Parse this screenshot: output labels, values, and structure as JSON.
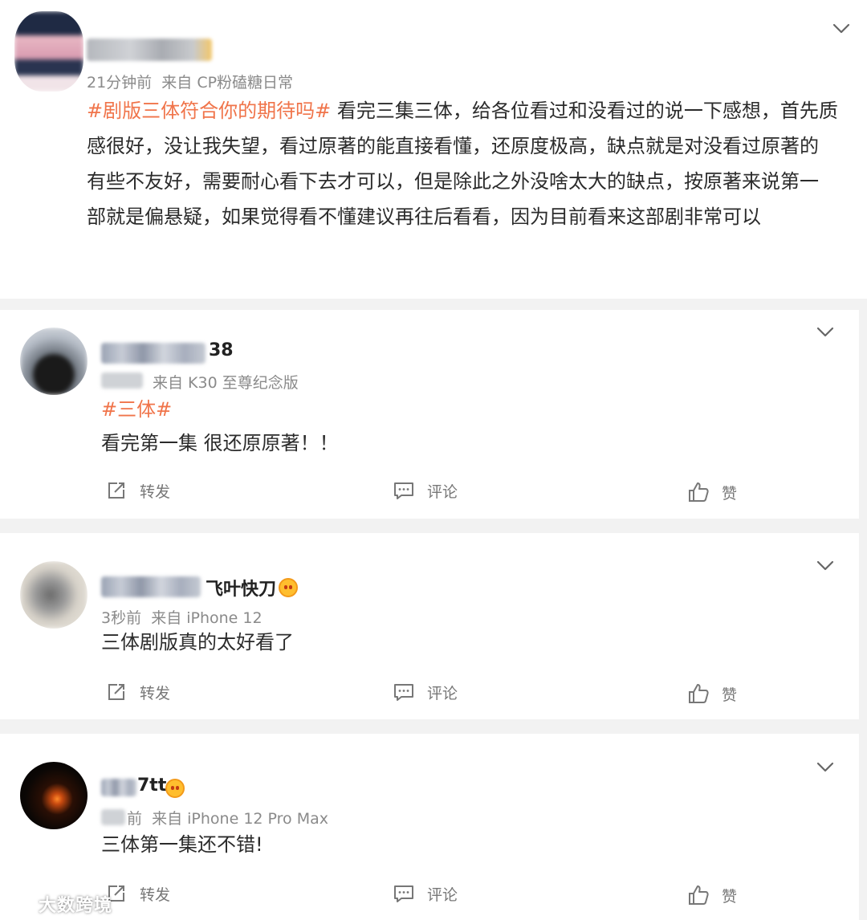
{
  "post": {
    "time": "21分钟前",
    "source": "来自 CP粉磕糖日常",
    "topic": "#剧版三体符合你的期待吗#",
    "lines": [
      "看完三集三体，给各位看过和没看过的说一下感想，首先质",
      "感很好，没让我失望，看过原著的能直接看懂，还原度极高，缺点就是对没看过原著的",
      "有些不友好，需要耐心看下去才可以，但是除此之外没啥太大的缺点，按原著来说第一",
      "部就是偏悬疑，如果觉得看不懂建议再往后看看，因为目前看来这部剧非常可以"
    ]
  },
  "comments": [
    {
      "name_visible": "38",
      "source": "来自 K30 至尊纪念版",
      "topic": "#三体#",
      "text": "看完第一集 很还原原著！！",
      "actions": {
        "repost": "转发",
        "comment": "评论",
        "like": "赞"
      }
    },
    {
      "name_visible": "飞叶快刀",
      "time": "3秒前",
      "source": "来自 iPhone 12",
      "text": "三体剧版真的太好看了",
      "actions": {
        "repost": "转发",
        "comment": "评论",
        "like": "赞"
      }
    },
    {
      "name_visible": "7tt",
      "time_suffix": "前",
      "source": "来自 iPhone 12 Pro Max",
      "text": "三体第一集还不错!",
      "actions": {
        "repost": "转发",
        "comment": "评论",
        "like": "赞"
      }
    }
  ],
  "watermark": {
    "text": "大数跨境"
  },
  "icons": {
    "expand": "chevron-down-icon",
    "repost": "repost-icon",
    "comment": "comment-icon",
    "like": "thumbs-up-icon",
    "badge": "emoji-badge-icon"
  },
  "colors": {
    "topic": "#f0744a",
    "meta": "#8a8a8a",
    "background": "#f2f2f2"
  }
}
